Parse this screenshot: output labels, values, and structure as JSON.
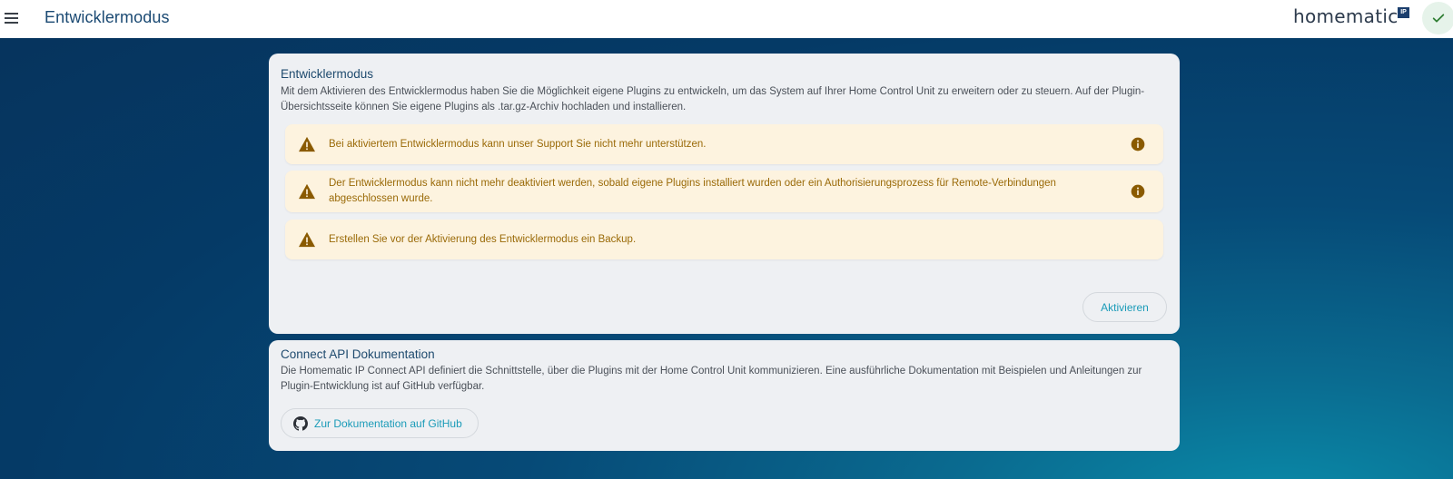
{
  "header": {
    "title": "Entwicklermodus",
    "menu_icon": "hamburger-menu-icon",
    "logo_text": "homematic",
    "logo_badge": "IP",
    "status_icon": "check-icon",
    "status_color": "#2e7d32"
  },
  "developer_card": {
    "title": "Entwicklermodus",
    "description": "Mit dem Aktivieren des Entwicklermodus haben Sie die Möglichkeit eigene Plugins zu entwickeln, um das System auf Ihrer Home Control Unit zu erweitern oder zu steuern. Auf der Plugin-Übersichtsseite können Sie eigene Plugins als .tar.gz-Archiv hochladen und installieren.",
    "warnings": [
      {
        "text": "Bei aktiviertem Entwicklermodus kann unser Support Sie nicht mehr unterstützen.",
        "has_info": true
      },
      {
        "text": "Der Entwicklermodus kann nicht mehr deaktiviert werden, sobald eigene Plugins installiert wurden oder ein Authorisierungsprozess für Remote-Verbindungen abgeschlossen wurde.",
        "has_info": true
      },
      {
        "text": "Erstellen Sie vor der Aktivierung des Entwicklermodus ein Backup.",
        "has_info": false
      }
    ],
    "activate_label": "Aktivieren"
  },
  "api_card": {
    "title": "Connect API Dokumentation",
    "description": "Die Homematic IP Connect API definiert die Schnittstelle, über die Plugins mit der Home Control Unit kommunizieren. Eine ausführliche Dokumentation mit Beispielen und Anleitungen zur Plugin-Entwicklung ist auf GitHub verfügbar.",
    "github_label": "Zur Dokumentation auf GitHub",
    "github_icon": "github-icon"
  },
  "colors": {
    "accent": "#1a9bb8",
    "warning_bg": "#fdf3df",
    "warning_text": "#9a6a08",
    "warning_icon": "#8a5a00",
    "title_blue": "#1b4a73"
  }
}
